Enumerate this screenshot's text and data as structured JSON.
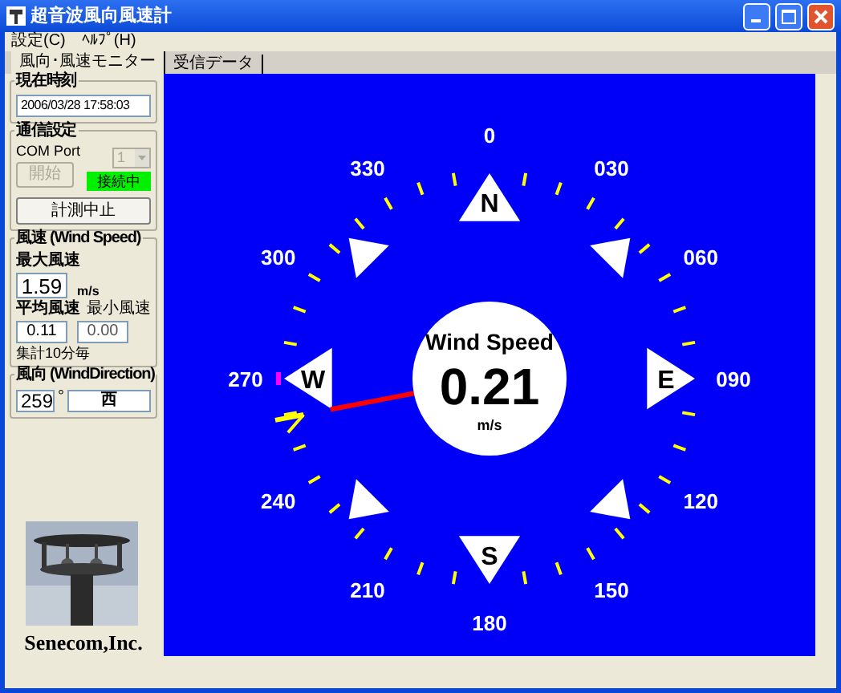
{
  "window": {
    "title": "超音波風向風速計"
  },
  "menu": [
    "設定(C)",
    "ﾍﾙﾌﾟ(H)"
  ],
  "tabs": [
    {
      "label": "風向･風速モニター",
      "selected": true
    },
    {
      "label": "受信データ",
      "selected": false
    }
  ],
  "current_time": {
    "title": "現在時刻",
    "value": "2006/03/28 17:58:03"
  },
  "comm": {
    "title": "通信設定",
    "port_label": "COM Port",
    "port": "1",
    "port_disabled": true,
    "start_button": "開始",
    "start_disabled": true,
    "status": "接続中",
    "connected": true,
    "stop_button": "計測中止"
  },
  "wind_speed": {
    "title": "風速 (Wind Speed)",
    "max_label": "最大風速",
    "max": "1.59",
    "unit": "m/s",
    "avg_label": "平均風速",
    "avg": "0.11",
    "min_label": "最小風速",
    "min": "0.00",
    "note": "集計10分毎"
  },
  "wind_direction": {
    "title": "風向 (WindDirection)",
    "degrees": "259",
    "degree_sign": "°",
    "name": "西"
  },
  "company": "Senecom,Inc.",
  "dial": {
    "bearings": [
      "0",
      "030",
      "060",
      "090",
      "120",
      "150",
      "180",
      "210",
      "240",
      "270",
      "300",
      "330"
    ],
    "cardinals": [
      "N",
      "E",
      "S",
      "W"
    ],
    "center_title": "Wind Speed",
    "center_value": "0.21",
    "center_unit": "m/s"
  }
}
